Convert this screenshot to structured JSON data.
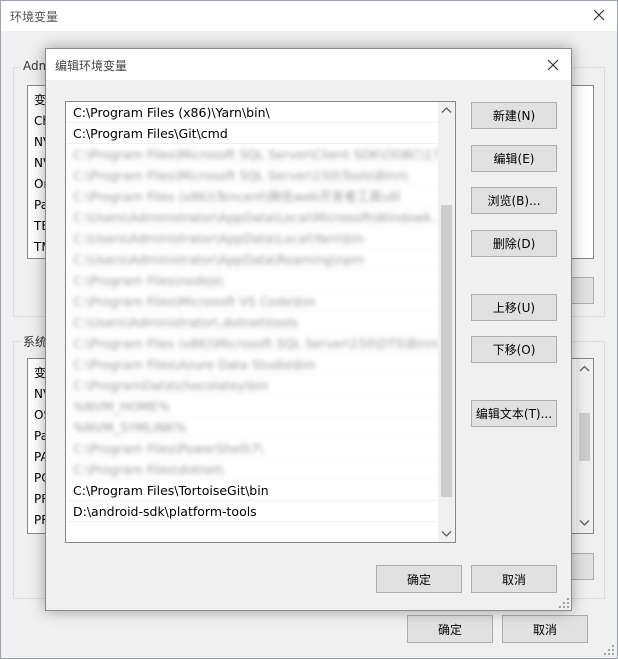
{
  "background_window": {
    "title": "环境变量",
    "user_group_label": "Adm",
    "user_vars": [
      "变",
      "Ch",
      "NV",
      "NV",
      "On",
      "Pa",
      "TE",
      "TM"
    ],
    "system_group_label": "系统",
    "system_vars": [
      "变",
      "NV",
      "OS",
      "Pa",
      "PA",
      "PC",
      "PR",
      "PR"
    ],
    "ok_label": "确定",
    "cancel_label": "取消"
  },
  "dialog": {
    "title": "编辑环境变量",
    "paths": [
      {
        "text": "C:\\Program Files (x86)\\Yarn\\bin\\",
        "blurred": false
      },
      {
        "text": "C:\\Program Files\\Git\\cmd",
        "blurred": false
      },
      {
        "text": "C:\\Program Files\\Microsoft SQL Server\\Client SDK\\ODBC\\17...",
        "blurred": true
      },
      {
        "text": "C:\\Program Files\\Microsoft SQL Server\\150\\Tools\\Binn\\",
        "blurred": true
      },
      {
        "text": "C:\\Program Files (x86)\\Tencent\\微信web开发者工具\\dll",
        "blurred": true
      },
      {
        "text": "C:\\Users\\Administrator\\AppData\\Local\\Microsoft\\Windowk...",
        "blurred": true
      },
      {
        "text": "C:\\Users\\Administrator\\AppData\\Local\\Yarn\\bin",
        "blurred": true
      },
      {
        "text": "C:\\Users\\Administrator\\AppData\\Roaming\\npm",
        "blurred": true
      },
      {
        "text": "C:\\Program Files\\nodejs\\",
        "blurred": true
      },
      {
        "text": "C:\\Program Files\\Microsoft VS Code\\bin",
        "blurred": true
      },
      {
        "text": "C:\\Users\\Administrator\\.dotnet\\tools",
        "blurred": true
      },
      {
        "text": "C:\\Program Files (x86)\\Microsoft SQL Server\\150\\DTS\\Binn\\",
        "blurred": true
      },
      {
        "text": "C:\\Program Files\\Azure Data Studio\\bin",
        "blurred": true
      },
      {
        "text": "C:\\ProgramData\\chocolatey\\bin",
        "blurred": true
      },
      {
        "text": "%NVM_HOME%",
        "blurred": true
      },
      {
        "text": "%NVM_SYMLINK%",
        "blurred": true
      },
      {
        "text": "C:\\Program Files\\PowerShell\\7\\",
        "blurred": true
      },
      {
        "text": "C:\\Program Files\\dotnet\\",
        "blurred": true
      },
      {
        "text": "C:\\Program Files\\TortoiseGit\\bin",
        "blurred": false
      },
      {
        "text": "D:\\android-sdk\\platform-tools",
        "blurred": false
      }
    ],
    "buttons": {
      "new": "新建(N)",
      "edit": "编辑(E)",
      "browse": "浏览(B)...",
      "delete": "删除(D)",
      "move_up": "上移(U)",
      "move_down": "下移(O)",
      "edit_text": "编辑文本(T)...",
      "ok": "确定",
      "cancel": "取消"
    },
    "scroll_position": 0.75
  }
}
